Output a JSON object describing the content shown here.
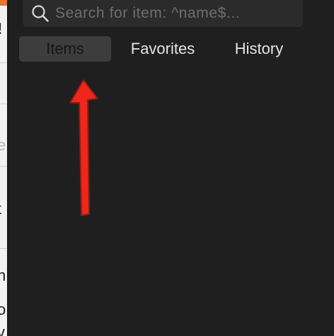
{
  "background_window": {
    "fragments": [
      "!",
      "e",
      "t",
      "h",
      "o",
      "v"
    ]
  },
  "search": {
    "placeholder": "Search for item: ^name$...",
    "value": "",
    "icon": "search-icon"
  },
  "tabs": [
    {
      "label": "Items",
      "active": true
    },
    {
      "label": "Favorites",
      "active": false
    },
    {
      "label": "History",
      "active": false
    }
  ],
  "annotation": {
    "type": "arrow",
    "color": "#f0261b",
    "direction": "up",
    "points_to": "Items"
  }
}
